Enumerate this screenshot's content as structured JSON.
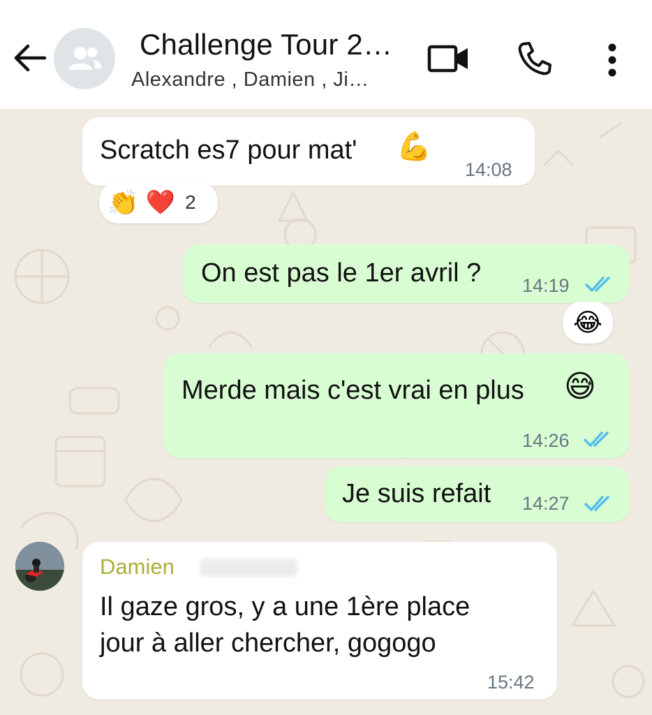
{
  "header": {
    "title": "Challenge Tour 2…",
    "subtitle": "Alexandre , Damien , Ji…",
    "icons": [
      "arrow-left-icon",
      "group-avatar-icon",
      "video-call-icon",
      "phone-icon",
      "more-vertical-icon"
    ]
  },
  "messages": [
    {
      "direction": "incoming",
      "text": "Scratch es7 pour mat'",
      "emoji": "💪",
      "time": "14:08",
      "reactions": {
        "emojis": [
          "👏",
          "❤️"
        ],
        "count": "2"
      }
    },
    {
      "direction": "outgoing",
      "text": "On est pas le 1er avril ?",
      "time": "14:19",
      "status": "read",
      "reactions": {
        "emojis": [
          "😂"
        ]
      }
    },
    {
      "direction": "outgoing",
      "text": "Merde mais c'est vrai en plus",
      "emoji": "😅",
      "time": "14:26",
      "status": "read"
    },
    {
      "direction": "outgoing",
      "text": "Je suis refait",
      "time": "14:27",
      "status": "read"
    },
    {
      "direction": "incoming",
      "sender": "Damien",
      "lines": [
        "Il gaze gros, y a une 1ère place",
        "jour à aller chercher, gogogo"
      ],
      "time": "15:42"
    }
  ],
  "colors": {
    "header_bg": "#ffffff",
    "chat_bg": "#efeae2",
    "incoming_bg": "#ffffff",
    "outgoing_bg": "#d9fdd3",
    "read_ticks": "#53bdeb",
    "sender_name": "#a8b03a",
    "time": "#667781"
  }
}
